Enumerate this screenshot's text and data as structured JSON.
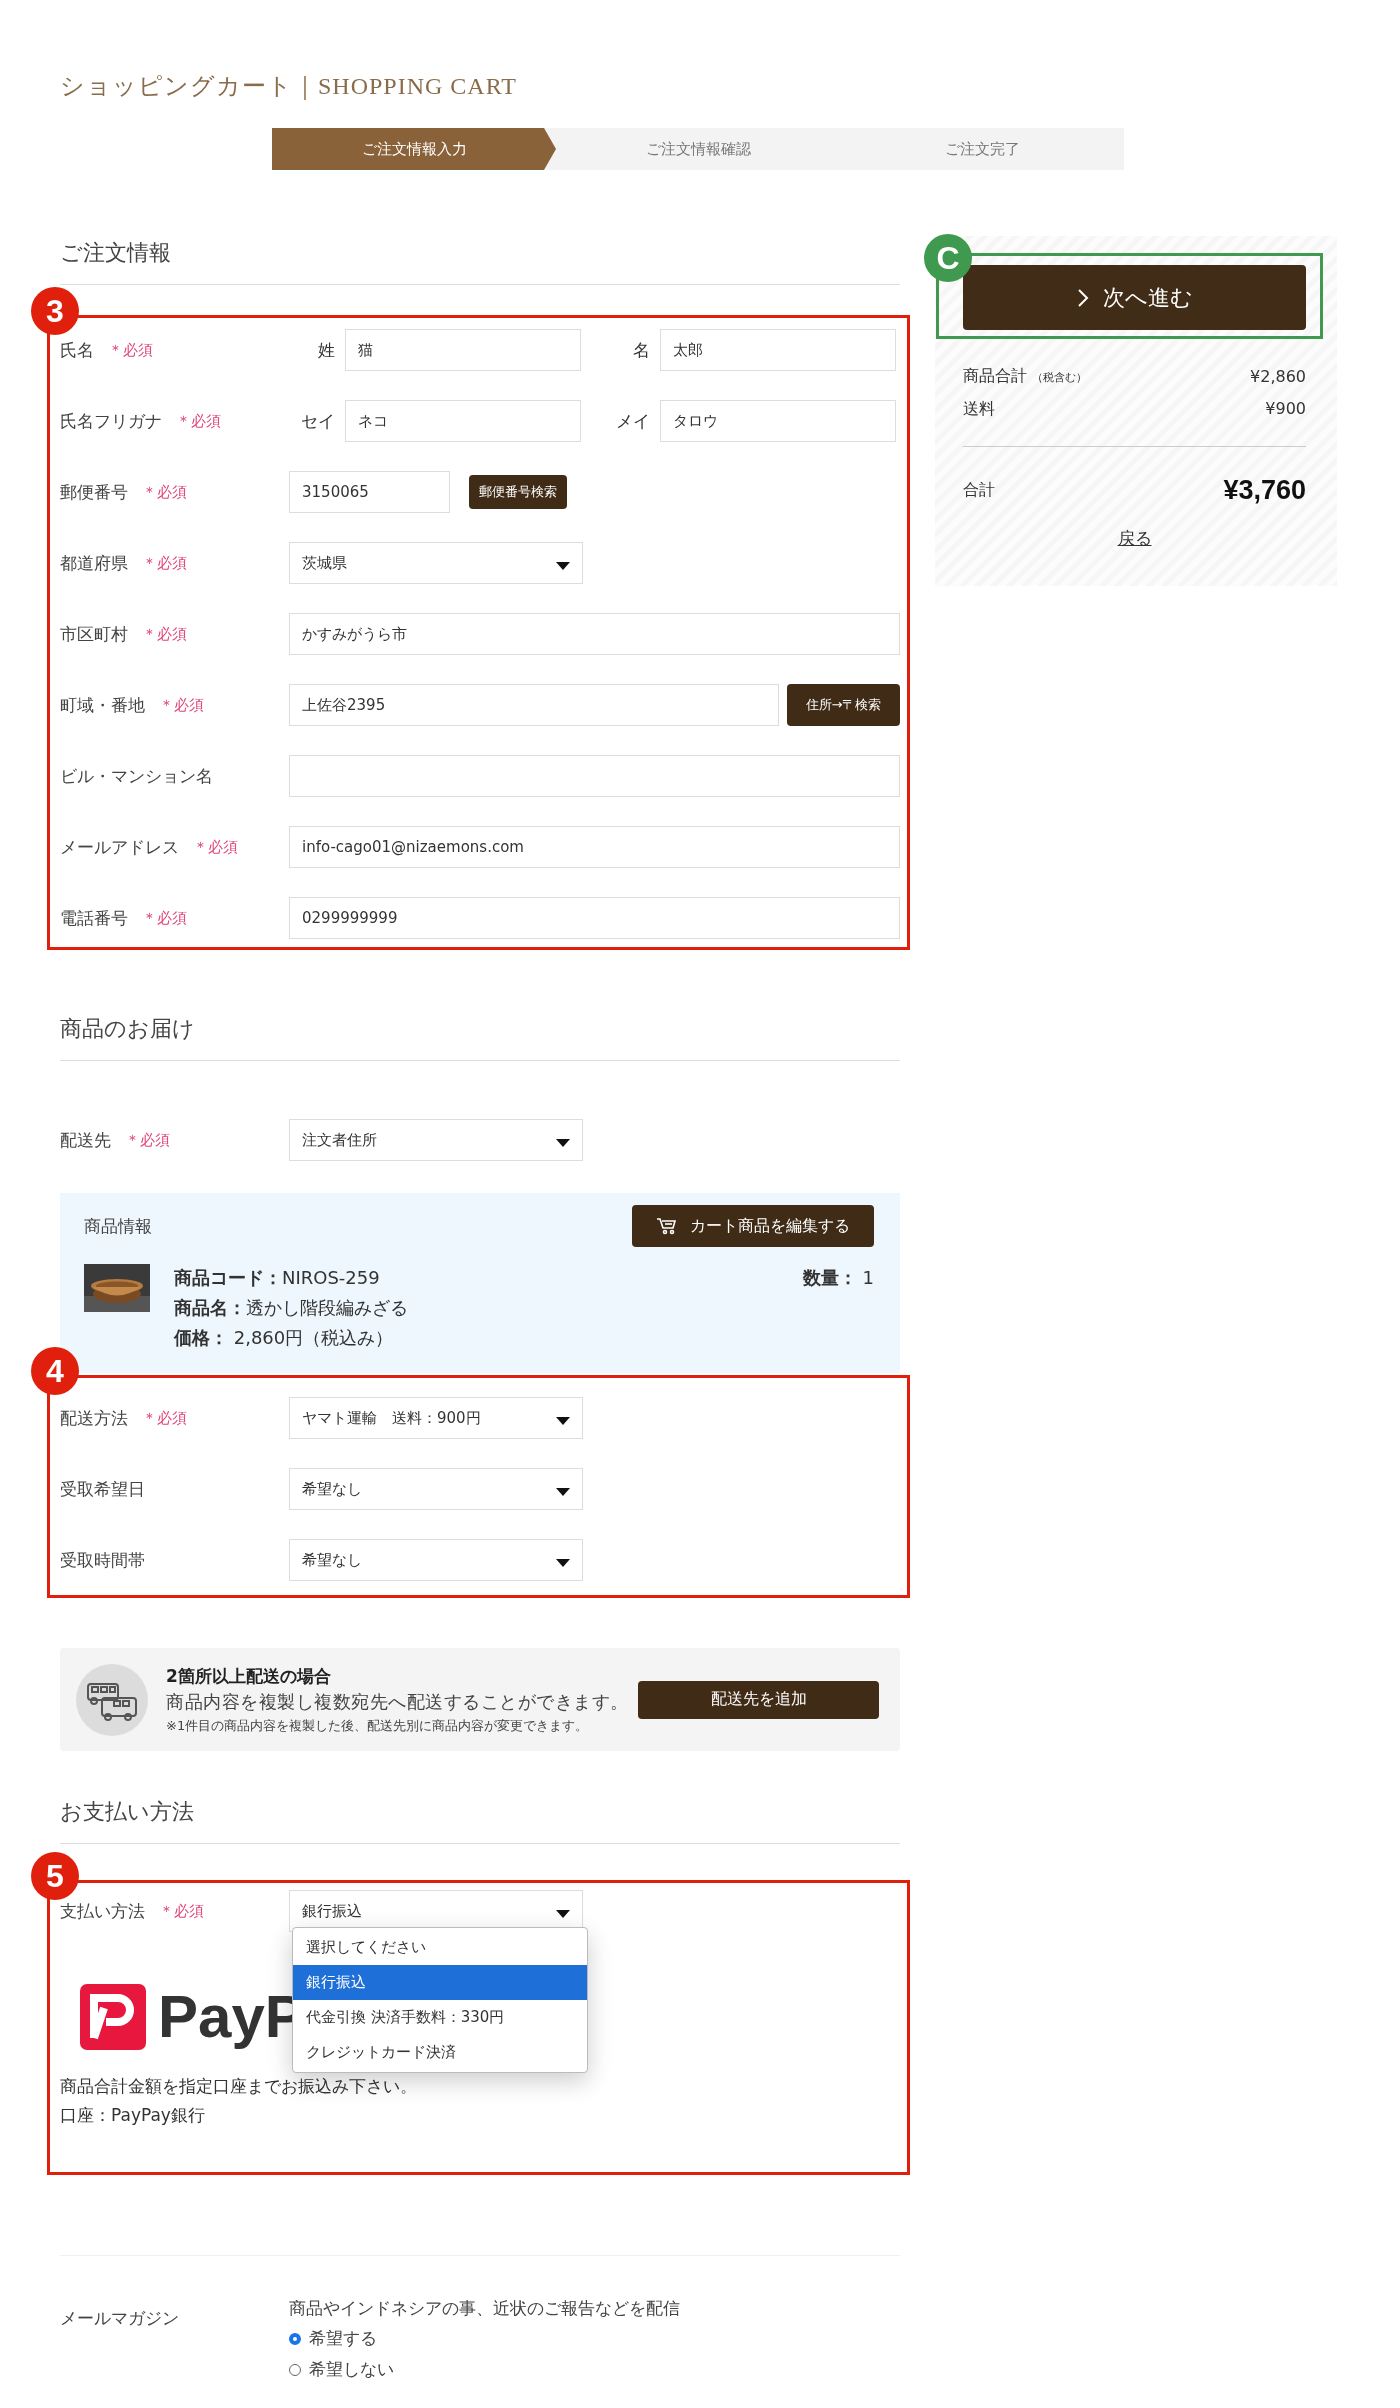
{
  "header": {
    "title": "ショッピングカート｜SHOPPING CART"
  },
  "steps": [
    {
      "label": "ご注文情報入力",
      "selected": true
    },
    {
      "label": "ご注文情報確認",
      "selected": false
    },
    {
      "label": "ご注文完了",
      "selected": false
    }
  ],
  "order_info": {
    "heading": "ご注文情報",
    "badge": "3",
    "fields": [
      {
        "kind": "pair",
        "label": "氏名",
        "required": "＊必須",
        "parts": [
          {
            "label": "姓",
            "value": "猫"
          },
          {
            "label": "名",
            "value": "太郎"
          }
        ]
      },
      {
        "kind": "pair",
        "label": "氏名フリガナ",
        "required": "＊必須",
        "parts": [
          {
            "label": "セイ",
            "value": "ネコ"
          },
          {
            "label": "メイ",
            "value": "タロウ"
          }
        ]
      },
      {
        "kind": "short_button",
        "label": "郵便番号",
        "required": "＊必須",
        "value": "3150065",
        "button": "郵便番号検索"
      },
      {
        "kind": "select",
        "label": "都道府県",
        "required": "＊必須",
        "value": "茨城県"
      },
      {
        "kind": "text",
        "label": "市区町村",
        "required": "＊必須",
        "value": "かすみがうら市"
      },
      {
        "kind": "text_button",
        "label": "町域・番地",
        "required": "＊必須",
        "value": "上佐谷2395",
        "button": "住所→〒検索"
      },
      {
        "kind": "text",
        "label": "ビル・マンション名"
      },
      {
        "kind": "text",
        "label": "メールアドレス",
        "required": "＊必須",
        "value": "info-cago01@nizaemons.com"
      },
      {
        "kind": "text",
        "label": "電話番号",
        "required": "＊必須",
        "value": "0299999999"
      }
    ]
  },
  "delivery": {
    "heading": "商品のお届け",
    "destination": {
      "kind": "select",
      "label": "配送先",
      "required": "＊必須",
      "value": "注文者住所"
    },
    "product_box": {
      "title": "商品情報",
      "edit_button": "カート商品を編集する",
      "code_label": "商品コード：",
      "code": "NIROS-259",
      "name_label": "商品名：",
      "name": "透かし階段編みざる",
      "price_label": "価格：",
      "price": "2,860円（税込み）",
      "quantity_label": "数量：",
      "quantity": "1"
    },
    "badge": "4",
    "fields": [
      {
        "kind": "select",
        "label": "配送方法",
        "required": "＊必須",
        "value": "ヤマト運輸　送料：900円"
      },
      {
        "kind": "select",
        "label": "受取希望日",
        "value": "希望なし"
      },
      {
        "kind": "select",
        "label": "受取時間帯",
        "value": "希望なし"
      }
    ]
  },
  "multi_delivery": {
    "title": "2箇所以上配送の場合",
    "text": "商品内容を複製し複数宛先へ配送することができます。",
    "note": "※1件目の商品内容を複製した後、配送先別に商品内容が変更できます。",
    "button": "配送先を追加"
  },
  "payment": {
    "heading": "お支払い方法",
    "badge": "5",
    "label": "支払い方法",
    "required": "＊必須",
    "value": "銀行振込",
    "options": [
      {
        "label": "選択してください",
        "selected": false
      },
      {
        "label": "銀行振込",
        "selected": true
      },
      {
        "label": "代金引換 決済手数料：330円",
        "selected": false
      },
      {
        "label": "クレジットカード決済",
        "selected": false
      }
    ],
    "logo_text": "PayP",
    "lines": [
      "商品合計金額を指定口座までお振込み下さい。",
      "口座：PayPay銀行"
    ]
  },
  "mail_magazine": {
    "label": "メールマガジン",
    "description": "商品やインドネシアの事、近状のご報告などを配信",
    "radios": [
      {
        "label": "希望する",
        "selected": true
      },
      {
        "label": "希望しない",
        "selected": false
      }
    ]
  },
  "sidebar": {
    "badge": "C",
    "next_button": "次へ進む",
    "subtotal_label": "商品合計",
    "subtotal_note": "（税含む）",
    "subtotal": "¥2,860",
    "shipping_label": "送料",
    "shipping": "¥900",
    "total_label": "合計",
    "total": "¥3,760",
    "back_link": "戻る"
  }
}
